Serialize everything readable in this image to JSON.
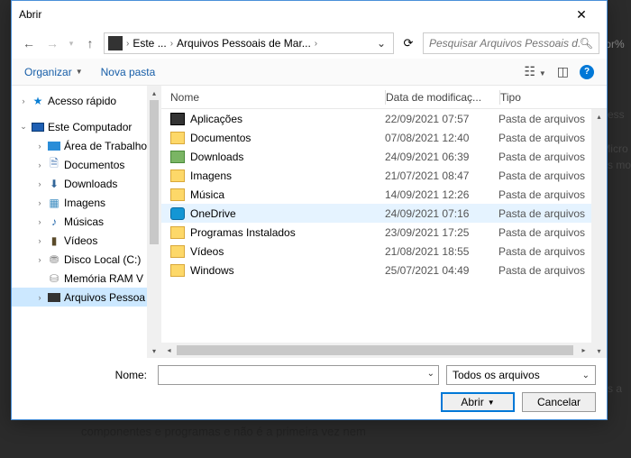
{
  "window": {
    "title": "Abrir"
  },
  "breadcrumb": {
    "root": "Este ...",
    "path": "Arquivos Pessoais de Mar..."
  },
  "search": {
    "placeholder": "Pesquisar Arquivos Pessoais d..."
  },
  "toolbar": {
    "organize": "Organizar",
    "newfolder": "Nova pasta"
  },
  "columns": {
    "name": "Nome",
    "date": "Data de modificaç...",
    "type": "Tipo"
  },
  "sidebar": {
    "quick": "Acesso rápido",
    "pc": "Este Computador",
    "desktop": "Área de Trabalho",
    "docs": "Documentos",
    "downloads": "Downloads",
    "images": "Imagens",
    "music": "Músicas",
    "videos": "Vídeos",
    "disk": "Disco Local (C:)",
    "ram": "Memória RAM V",
    "personal": "Arquivos Pessoa"
  },
  "files": [
    {
      "name": "Aplicações",
      "date": "22/09/2021 07:57",
      "type": "Pasta de arquivos",
      "icon": "app"
    },
    {
      "name": "Documentos",
      "date": "07/08/2021 12:40",
      "type": "Pasta de arquivos",
      "icon": ""
    },
    {
      "name": "Downloads",
      "date": "24/09/2021 06:39",
      "type": "Pasta de arquivos",
      "icon": "dl"
    },
    {
      "name": "Imagens",
      "date": "21/07/2021 08:47",
      "type": "Pasta de arquivos",
      "icon": ""
    },
    {
      "name": "Música",
      "date": "14/09/2021 12:26",
      "type": "Pasta de arquivos",
      "icon": ""
    },
    {
      "name": "OneDrive",
      "date": "24/09/2021 07:16",
      "type": "Pasta de arquivos",
      "icon": "onedrive",
      "selected": true
    },
    {
      "name": "Programas Instalados",
      "date": "23/09/2021 17:25",
      "type": "Pasta de arquivos",
      "icon": ""
    },
    {
      "name": "Vídeos",
      "date": "21/08/2021 18:55",
      "type": "Pasta de arquivos",
      "icon": ""
    },
    {
      "name": "Windows",
      "date": "25/07/2021 04:49",
      "type": "Pasta de arquivos",
      "icon": ""
    }
  ],
  "footer": {
    "name_label": "Nome:",
    "name_value": "",
    "filter": "Todos os arquivos",
    "open": "Abrir",
    "cancel": "Cancelar"
  },
  "background": {
    "url_fragment": "-br%",
    "snippets": [
      "pess",
      "Micro",
      "os mo",
      "os a"
    ],
    "text": "componentes e programas e não é a primeira vez nem"
  }
}
